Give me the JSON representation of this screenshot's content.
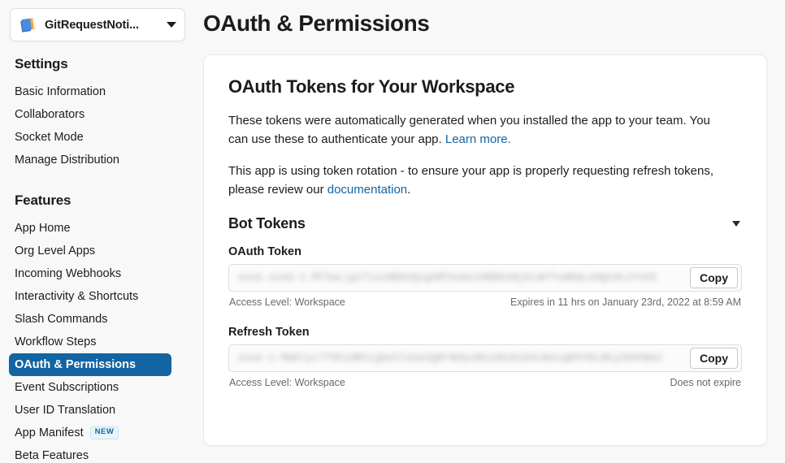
{
  "sidebar": {
    "app_selector": {
      "name": "GitRequestNoti...",
      "icon": "books-icon",
      "caret": "chevron-down-icon"
    },
    "groups": [
      {
        "heading": "Settings",
        "items": [
          {
            "label": "Basic Information",
            "selected": false
          },
          {
            "label": "Collaborators",
            "selected": false
          },
          {
            "label": "Socket Mode",
            "selected": false
          },
          {
            "label": "Manage Distribution",
            "selected": false
          }
        ]
      },
      {
        "heading": "Features",
        "items": [
          {
            "label": "App Home",
            "selected": false
          },
          {
            "label": "Org Level Apps",
            "selected": false
          },
          {
            "label": "Incoming Webhooks",
            "selected": false
          },
          {
            "label": "Interactivity & Shortcuts",
            "selected": false
          },
          {
            "label": "Slash Commands",
            "selected": false
          },
          {
            "label": "Workflow Steps",
            "selected": false
          },
          {
            "label": "OAuth & Permissions",
            "selected": true
          },
          {
            "label": "Event Subscriptions",
            "selected": false
          },
          {
            "label": "User ID Translation",
            "selected": false
          },
          {
            "label": "App Manifest",
            "selected": false,
            "badge": "NEW"
          },
          {
            "label": "Beta Features",
            "selected": false
          }
        ]
      }
    ]
  },
  "main": {
    "page_title": "OAuth & Permissions",
    "card": {
      "title": "OAuth Tokens for Your Workspace",
      "paragraph1_part1": "These tokens were automatically generated when you installed the app to your team. You can use these to authenticate your app. ",
      "paragraph1_link": "Learn more.",
      "paragraph2_part1": "This app is using token rotation - to ensure your app is properly requesting refresh tokens, please review our ",
      "paragraph2_link": "documentation",
      "paragraph2_part2": ".",
      "section": {
        "heading": "Bot Tokens",
        "caret": "chevron-down-icon"
      },
      "tokens": [
        {
          "label": "OAuth Token",
          "value": "xoxe.xoxb-1-MTIwLjg1TiszNDU2Qzg5RTAxmzI0NDU2NjkLWYTcmRqLsOQ2dnJYcES",
          "copy_label": "Copy",
          "access_level": "Access Level: Workspace",
          "expiry": "Expires in 11 hrs on January 23rd, 2022 at 8:59 AM"
        },
        {
          "label": "Refresh Token",
          "value": "xoxe-1-Mw0lyc7T9hzdM1cgbeY14ue3gRrB4qJ8kzdkoKsO4JmnxgbhYDLdkyZb0VWoC",
          "copy_label": "Copy",
          "access_level": "Access Level: Workspace",
          "expiry": "Does not expire"
        }
      ]
    }
  },
  "colors": {
    "accent": "#1264a3",
    "selected_bg": "#1264a3",
    "page_bg": "#f8f8f8",
    "card_bg": "#ffffff",
    "text": "#1d1c1d",
    "muted_text": "#696969",
    "badge_bg": "#e8f5fa"
  }
}
